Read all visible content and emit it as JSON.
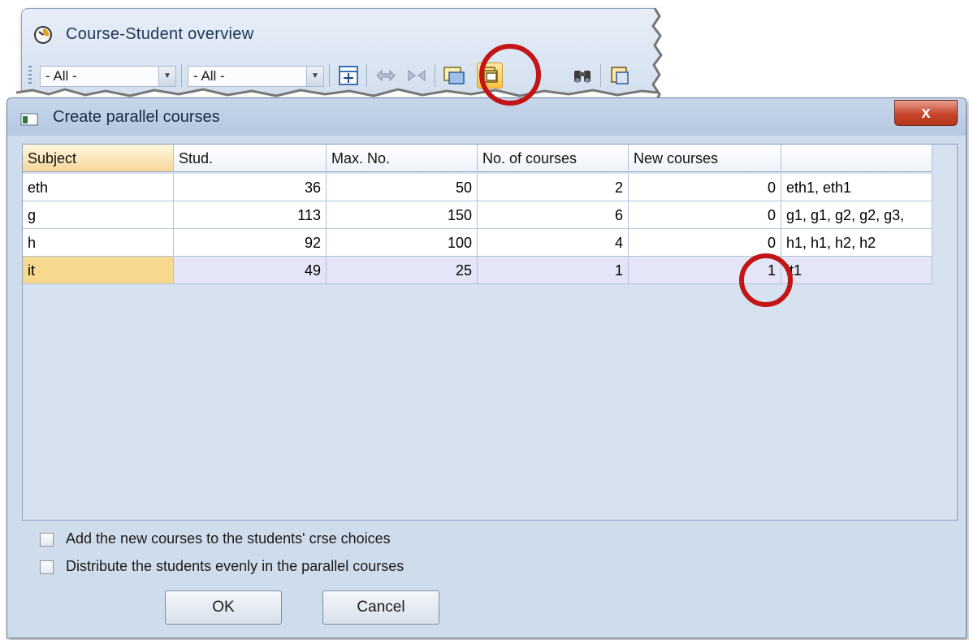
{
  "back_window": {
    "title": "Course-Student overview",
    "combo1_value": "- All -",
    "combo2_value": "- All -"
  },
  "dialog": {
    "title": "Create parallel courses",
    "close_glyph": "x",
    "columns": [
      "Subject",
      "Stud.",
      "Max. No.",
      "No. of courses",
      "New courses",
      ""
    ],
    "rows": [
      {
        "subject": "eth",
        "stud": "36",
        "max": "50",
        "courses": "2",
        "new": "0",
        "list": "eth1, eth1"
      },
      {
        "subject": "g",
        "stud": "113",
        "max": "150",
        "courses": "6",
        "new": "0",
        "list": "g1, g1, g2, g2, g3,"
      },
      {
        "subject": "h",
        "stud": "92",
        "max": "100",
        "courses": "4",
        "new": "0",
        "list": "h1, h1, h2, h2"
      },
      {
        "subject": "it",
        "stud": "49",
        "max": "25",
        "courses": "1",
        "new": "1",
        "list": "it1"
      }
    ],
    "options": [
      {
        "label": "Add the new courses to the students' crse choices",
        "checked": false
      },
      {
        "label": "Distribute the students evenly in the parallel courses",
        "checked": false
      }
    ],
    "ok_label": "OK",
    "cancel_label": "Cancel"
  },
  "annotation_color": "#c11516"
}
